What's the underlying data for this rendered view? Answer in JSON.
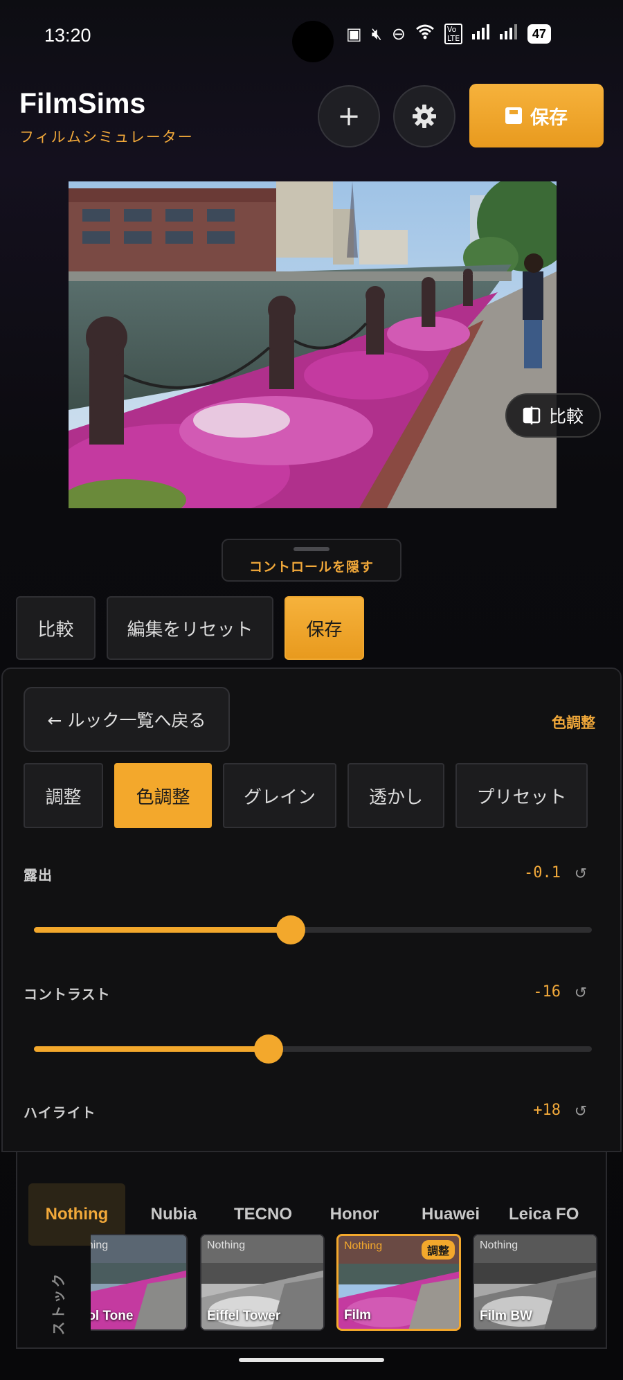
{
  "status": {
    "time": "13:20",
    "battery": "47",
    "volte": "Vo LTE"
  },
  "header": {
    "title": "FilmSims",
    "subtitle": "フィルムシミュレーター",
    "save_label": "保存",
    "add_glyph": "+"
  },
  "preview": {
    "compare_label": "比較"
  },
  "controls": {
    "hide_label": "コントロールを隠す"
  },
  "actions": {
    "compare": "比較",
    "reset": "編集をリセット",
    "save": "保存"
  },
  "panel": {
    "back_label": "← ルック一覧へ戻る",
    "current_section": "色調整",
    "tabs": [
      {
        "label": "調整"
      },
      {
        "label": "色調整",
        "active": true
      },
      {
        "label": "グレイン"
      },
      {
        "label": "透かし"
      },
      {
        "label": "プリセット"
      }
    ],
    "sliders": [
      {
        "label": "露出",
        "value": "-0.1",
        "level": 0.46
      },
      {
        "label": "コントラスト",
        "value": "-16",
        "level": 0.42
      },
      {
        "label": "ハイライト",
        "value": "+18"
      }
    ]
  },
  "brands": {
    "tabs": [
      {
        "label": "Nothing",
        "active": true
      },
      {
        "label": "Nubia"
      },
      {
        "label": "TECNO"
      },
      {
        "label": "Honor"
      },
      {
        "label": "Huawei"
      },
      {
        "label": "Leica FO"
      }
    ],
    "category": "ストック",
    "looks": [
      {
        "brand": "Nothing",
        "name": "Cool Tone"
      },
      {
        "brand": "Nothing",
        "name": "Eiffel Tower"
      },
      {
        "brand": "Nothing",
        "name": "Film",
        "badge": "調整",
        "active": true
      },
      {
        "brand": "Nothing",
        "name": "Film BW"
      }
    ]
  },
  "colors": {
    "accent": "#f3a82c",
    "background": "#0b0b0e",
    "panel": "#111112"
  },
  "icons": [
    "plus-icon",
    "gear-icon",
    "save-disk-icon",
    "compare-split-icon",
    "reset-rotate-icon"
  ]
}
